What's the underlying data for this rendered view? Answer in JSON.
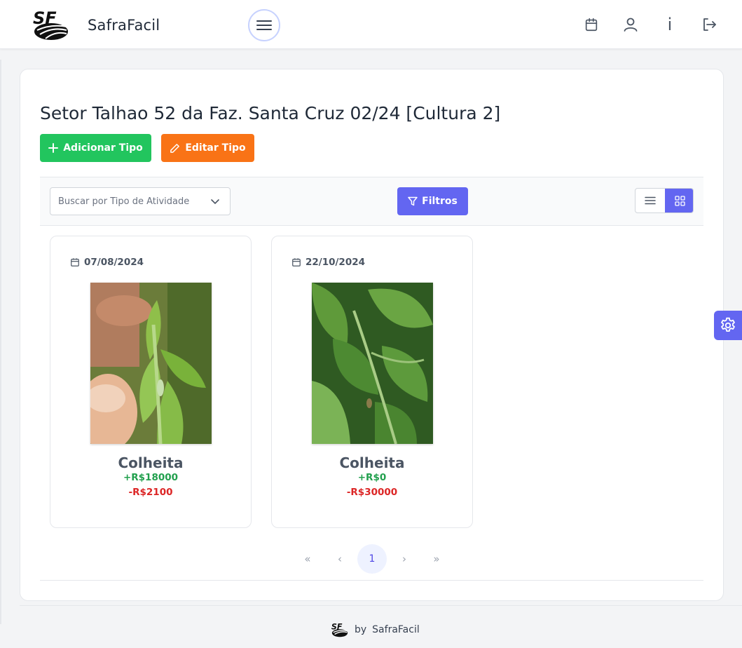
{
  "header": {
    "brand": "SafraFacil",
    "logo_icon": "safrafacil-logo",
    "menu_icon": "hamburger-icon",
    "actions": [
      "calendar-icon",
      "user-icon",
      "info-icon",
      "logout-icon"
    ],
    "info_glyph": "i"
  },
  "page": {
    "title": "Setor Talhao 52 da Faz. Santa Cruz 02/24 [Cultura 2]",
    "add_button": "Adicionar Tipo",
    "edit_button": "Editar Tipo"
  },
  "toolbar": {
    "search_placeholder": "Buscar por Tipo de Atividade",
    "filter_button": "Filtros",
    "view_modes": [
      "list",
      "grid"
    ],
    "selected_view": "grid"
  },
  "items": [
    {
      "date": "07/08/2024",
      "name": "Colheita",
      "income": "+R$18000",
      "expense": "-R$2100"
    },
    {
      "date": "22/10/2024",
      "name": "Colheita",
      "income": "+R$0",
      "expense": "-R$30000"
    }
  ],
  "pagination": {
    "first": "«",
    "prev": "‹",
    "current": "1",
    "next": "›",
    "last": "»"
  },
  "footer": {
    "by": "by",
    "brand": "SafraFacil"
  },
  "colors": {
    "primary": "#6366f1",
    "success": "#22c55e",
    "warning": "#f97316",
    "income": "#22a04e",
    "expense": "#dc2626"
  }
}
